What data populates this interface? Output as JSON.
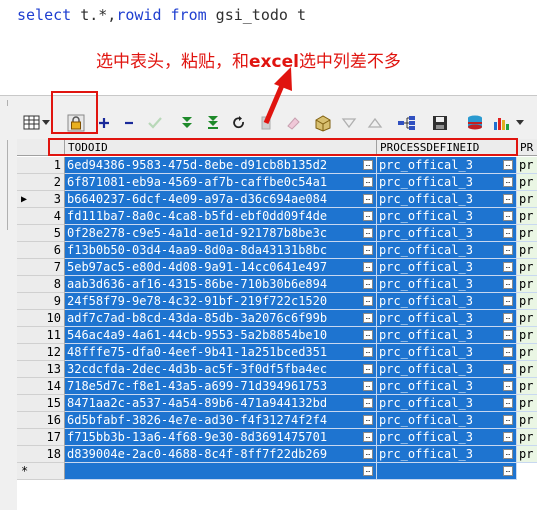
{
  "editor": {
    "sql": [
      {
        "text": "select",
        "kw": true
      },
      {
        "text": " t.*,",
        "kw": false
      },
      {
        "text": "rowid",
        "kw": true
      },
      {
        "text": " ",
        "kw": false
      },
      {
        "text": "from",
        "kw": true
      },
      {
        "text": " gsi_todo t",
        "kw": false
      }
    ]
  },
  "annotation": {
    "part1": "选中表头，粘贴，和",
    "part2": "excel",
    "part3": "选中列差不多",
    "color": "#e0140f"
  },
  "grid": {
    "columns": [
      "TODOID",
      "PROCESSDEFINEID",
      "PR"
    ],
    "selection_color": "#1e74d0",
    "rows": [
      {
        "n": "1",
        "id": "6ed94386-9583-475d-8ebe-d91cb8b135d2",
        "proc": "prc_offical_3",
        "extra": "pr"
      },
      {
        "n": "2",
        "id": "6f871081-eb9a-4569-af7b-caffbe0c54a1",
        "proc": "prc_offical_3",
        "extra": "pr"
      },
      {
        "n": "3",
        "id": "b6640237-6dcf-4e09-a97a-d36c694ae084",
        "proc": "prc_offical_3",
        "extra": "pr"
      },
      {
        "n": "4",
        "id": "fd111ba7-8a0c-4ca8-b5fd-ebf0dd09f4de",
        "proc": "prc_offical_3",
        "extra": "pr"
      },
      {
        "n": "5",
        "id": "0f28e278-c9e5-4a1d-ae1d-921787b8be3c",
        "proc": "prc_offical_3",
        "extra": "pr"
      },
      {
        "n": "6",
        "id": "f13b0b50-03d4-4aa9-8d0a-8da43131b8bc",
        "proc": "prc_offical_3",
        "extra": "pr"
      },
      {
        "n": "7",
        "id": "5eb97ac5-e80d-4d08-9a91-14cc0641e497",
        "proc": "prc_offical_3",
        "extra": "pr"
      },
      {
        "n": "8",
        "id": "aab3d636-af16-4315-86be-710b30b6e894",
        "proc": "prc_offical_3",
        "extra": "pr"
      },
      {
        "n": "9",
        "id": "24f58f79-9e78-4c32-91bf-219f722c1520",
        "proc": "prc_offical_3",
        "extra": "pr"
      },
      {
        "n": "10",
        "id": "adf7c7ad-b8cd-43da-85db-3a2076c6f99b",
        "proc": "prc_offical_3",
        "extra": "pr"
      },
      {
        "n": "11",
        "id": "546ac4a9-4a61-44cb-9553-5a2b8854be10",
        "proc": "prc_offical_3",
        "extra": "pr"
      },
      {
        "n": "12",
        "id": "48fffe75-dfa0-4eef-9b41-1a251bced351",
        "proc": "prc_offical_3",
        "extra": "pr"
      },
      {
        "n": "13",
        "id": "32cdcfda-2dec-4d3b-ac5f-3f0df5fba4ec",
        "proc": "prc_offical_3",
        "extra": "pr"
      },
      {
        "n": "14",
        "id": "718e5d7c-f8e1-43a5-a699-71d394961753",
        "proc": "prc_offical_3",
        "extra": "pr"
      },
      {
        "n": "15",
        "id": "8471aa2c-a537-4a54-89b6-471a944132bd",
        "proc": "prc_offical_3",
        "extra": "pr"
      },
      {
        "n": "16",
        "id": "6d5bfabf-3826-4e7e-ad30-f4f31274f2f4",
        "proc": "prc_offical_3",
        "extra": "pr"
      },
      {
        "n": "17",
        "id": "f715bb3b-13a6-4f68-9e30-8d3691475701",
        "proc": "prc_offical_3",
        "extra": "pr"
      },
      {
        "n": "18",
        "id": "d839004e-2ac0-4688-8c4f-8ff7f22db269",
        "proc": "prc_offical_3",
        "extra": "pr"
      }
    ],
    "new_row_marker": "*"
  },
  "toolbar": {
    "icons": [
      "grid-icon",
      "dropdown-arrow-icon",
      "lock-icon",
      "add-record-icon",
      "delete-record-icon",
      "post-changes-icon",
      "fetch-next-icon",
      "fetch-last-icon",
      "refresh-icon",
      "print-icon",
      "eraser-icon",
      "query-by-example-icon",
      "filter-icon",
      "up-icon",
      "tree-icon",
      "save-icon",
      "export-icon",
      "chart-icon",
      "chart-dropdown-icon"
    ]
  }
}
